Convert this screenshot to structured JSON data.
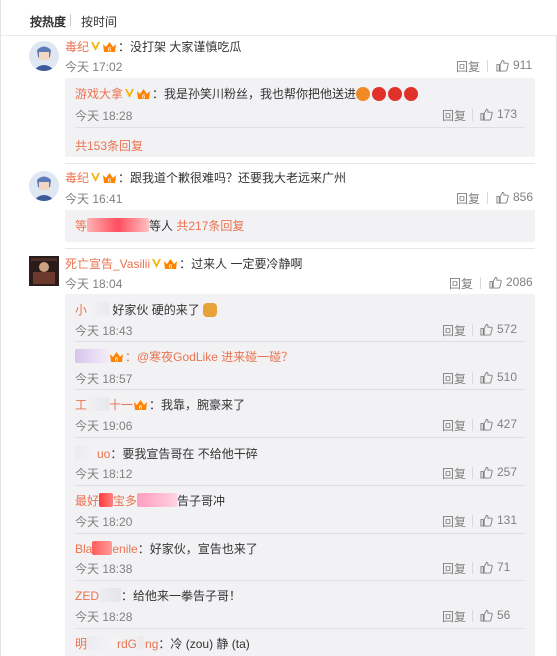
{
  "sort": {
    "hot": "按热度",
    "time": "按时间"
  },
  "comments": [
    {
      "user": "毒纪",
      "text": "：没打架 大家谨慎吃瓜",
      "time": "今天 17:02",
      "reply": "回复",
      "likes": "911"
    },
    {
      "user": "毒纪",
      "text": "：跟我道个歉很难吗？还要我大老远来广州",
      "time": "今天 16:41",
      "reply": "回复",
      "likes": "856"
    },
    {
      "user": "死亡宣告_Vasilii",
      "text": "：过来人 一定要冷静啊",
      "time": "今天 18:04",
      "reply": "回复",
      "likes": "2086"
    }
  ],
  "sub1": {
    "user": "游戏大拿",
    "text": "：我是孙笑川粉丝，我也帮你把他送进",
    "time": "今天 18:28",
    "reply": "回复",
    "likes": "173",
    "more": "共153条回复"
  },
  "sub2": {
    "pre": "等",
    "mid": "等人",
    "more": "共217条回复"
  },
  "replies": [
    {
      "user": "小",
      "text": "好家伙 硬的来了",
      "time": "今天 18:43",
      "reply": "回复",
      "likes": "572"
    },
    {
      "user": "",
      "text": "：@寒夜GodLike 进来碰一碰？",
      "time": "今天 18:57",
      "reply": "回复",
      "likes": "510"
    },
    {
      "user": "工",
      "user2": "十一",
      "text": "：我靠，腕豪来了",
      "time": "今天 19:06",
      "reply": "回复",
      "likes": "427"
    },
    {
      "user": "uo",
      "text": "：要我宣告哥在 不给他干碎",
      "time": "今天 18:12",
      "reply": "回复",
      "likes": "257"
    },
    {
      "user": "最好",
      "user2": "宝多",
      "text": "告子哥冲",
      "time": "今天 18:20",
      "reply": "回复",
      "likes": "131"
    },
    {
      "user": "Bla",
      "user2": "enile",
      "text": "：好家伙，宣告也来了",
      "time": "今天 18:38",
      "reply": "回复",
      "likes": "71"
    },
    {
      "user": "ZED",
      "text": "：给他来一拳告子哥！",
      "time": "今天 18:28",
      "reply": "回复",
      "likes": "56"
    },
    {
      "user": "明",
      "user2": "rdG",
      "user3": "ng",
      "text": "：冷 (zou) 静 (ta)"
    }
  ]
}
